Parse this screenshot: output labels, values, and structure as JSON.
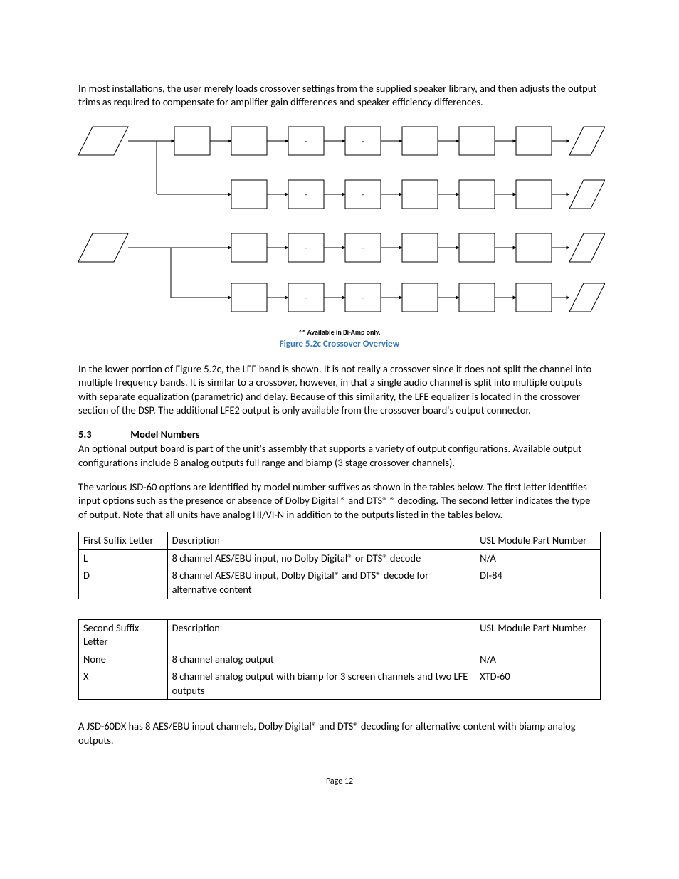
{
  "paragraphs": {
    "intro": "In most installations, the user merely loads crossover settings from the supplied speaker library, and then adjusts the output trims as required to compensate for amplifier gain differences and speaker efficiency differences.",
    "biamp_note": "** Available in Bi-Amp only.",
    "fig_caption": "Figure 5.2c Crossover Overview",
    "after_figure": "In the lower portion of Figure 5.2c, the LFE band is shown. It is not really a crossover since it does not split the channel into multiple frequency bands. It is similar to a crossover, however, in that a single audio channel is split into multiple outputs with separate equalization (parametric) and delay. Because of this similarity, the LFE equalizer is located in the crossover section of the DSP.  The additional LFE2 output is only available from the crossover board's output connector.",
    "section_num": "5.3",
    "section_title": "Model Numbers",
    "model_p1": "An optional output board is part of the unit's assembly that supports a variety of output configurations.  Available output configurations include 8 analog outputs full range and biamp (3 stage crossover channels).",
    "model_p2": "The various JSD-60 options are identified by model number suffixes as shown in the tables below.  The first letter identifies input options such as the presence or absence of Dolby Digital ® and DTS® ® decoding.  The second letter indicates the type of output.  Note that all units have analog HI/VI-N in addition to the outputs listed in the tables below.",
    "after_tables": "A JSD-60DX has 8 AES/EBU input channels, Dolby Digital® and DTS® decoding for alternative content with biamp analog outputs.",
    "page_num": "Page 12"
  },
  "diagram": {
    "rows": [
      {
        "input_label": "",
        "box1": "",
        "box2": "–",
        "box3": "–",
        "box4": "",
        "box5": "",
        "box6": "",
        "output": ""
      },
      {
        "input_label": "",
        "box1": "",
        "box2": "–",
        "box3": "–",
        "box4": "",
        "box5": "",
        "box6": "",
        "output": ""
      },
      {
        "input_label": "",
        "box1": "",
        "box2": "–",
        "box3": "–",
        "box4": "",
        "box5": "",
        "box6": "",
        "output": ""
      },
      {
        "input_label": "",
        "box1": "",
        "box2": "–",
        "box3": "–",
        "box4": "",
        "box5": "",
        "box6": "",
        "output": ""
      }
    ]
  },
  "table1": {
    "headers": [
      "First Suffix Letter",
      "Description",
      "USL Module Part Number"
    ],
    "rows": [
      [
        "L",
        "8 channel AES/EBU input, no Dolby Digital® or DTS®  decode",
        "N/A"
      ],
      [
        "D",
        "8 channel AES/EBU input, Dolby Digital® and DTS® decode for alternative content",
        "DI-84"
      ]
    ]
  },
  "table2": {
    "headers": [
      "Second Suffix Letter",
      "Description",
      "USL Module Part Number"
    ],
    "rows": [
      [
        "None",
        "8 channel analog output",
        "N/A"
      ],
      [
        "X",
        "8 channel analog output with biamp for 3 screen channels and two LFE  outputs",
        "XTD-60"
      ]
    ]
  }
}
